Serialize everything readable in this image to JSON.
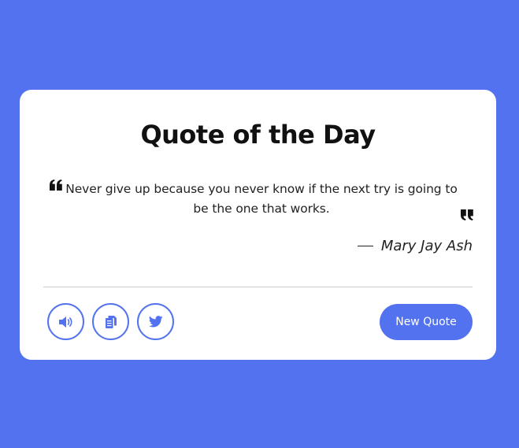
{
  "card": {
    "title": "Quote of the Day",
    "quote_text": "Never give up because you never know if the next try is going to be the one that works.",
    "author": "Mary Jay Ash"
  },
  "actions": {
    "speak_icon": "speaker-icon",
    "copy_icon": "copy-icon",
    "twitter_icon": "twitter-icon",
    "new_quote_label": "New Quote"
  },
  "colors": {
    "background": "#5372F0",
    "accent": "#5372F0",
    "card": "#ffffff",
    "text": "#111111"
  }
}
